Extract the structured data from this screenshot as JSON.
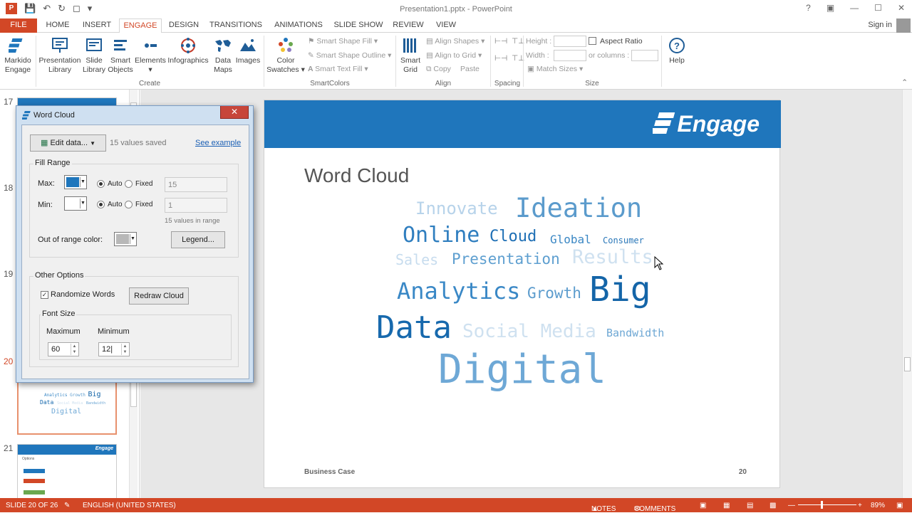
{
  "window": {
    "title": "Presentation1.pptx - PowerPoint",
    "signin": "Sign in"
  },
  "tabs": [
    "FILE",
    "HOME",
    "INSERT",
    "ENGAGE",
    "DESIGN",
    "TRANSITIONS",
    "ANIMATIONS",
    "SLIDE SHOW",
    "REVIEW",
    "VIEW"
  ],
  "ribbon": {
    "markido": [
      "Markido",
      "Engage"
    ],
    "create": {
      "presentation_library": [
        "Presentation",
        "Library"
      ],
      "slide_library": [
        "Slide",
        "Library"
      ],
      "smart_objects": [
        "Smart",
        "Objects"
      ],
      "elements": "Elements",
      "infographics": "Infographics",
      "data_maps": [
        "Data",
        "Maps"
      ],
      "images": "Images",
      "label": "Create"
    },
    "smartcolors": {
      "color_swatches": [
        "Color",
        "Swatches"
      ],
      "shape_fill": "Smart Shape Fill",
      "shape_outline": "Smart Shape Outline",
      "text_fill": "Smart Text Fill",
      "label": "SmartColors"
    },
    "align": {
      "smart_grid": [
        "Smart",
        "Grid"
      ],
      "align_shapes": "Align Shapes",
      "align_grid": "Align to Grid",
      "copy": "Copy",
      "paste": "Paste",
      "label": "Align"
    },
    "spacing": {
      "label": "Spacing"
    },
    "size": {
      "height": "Height :",
      "width": "Width :",
      "aspect": "Aspect Ratio",
      "columns": "or columns :",
      "match": "Match Sizes",
      "label": "Size"
    },
    "help": "Help"
  },
  "thumbnails": {
    "numbers": [
      "17",
      "18",
      "19",
      "20",
      "21"
    ],
    "slide20_words": [
      "Analytics",
      "Growth",
      "Big",
      "Data",
      "Social Media",
      "Bandwidth",
      "Digital"
    ],
    "slide21_title": "Options"
  },
  "slide": {
    "logo": "Engage",
    "title": "Word Cloud",
    "footer_left": "Business Case",
    "footer_right": "20",
    "words": [
      {
        "text": "Innovate",
        "color": "#b7d3ea"
      },
      {
        "text": "Ideation",
        "color": "#5b9bcc"
      },
      {
        "text": "Online",
        "color": "#2f7ebf"
      },
      {
        "text": "Cloud",
        "color": "#1e6fb5"
      },
      {
        "text": "Global",
        "color": "#3a87c4"
      },
      {
        "text": "Consumer",
        "color": "#2b78b9"
      },
      {
        "text": "Sales",
        "color": "#c7dcee"
      },
      {
        "text": "Presentation",
        "color": "#5e9fd0"
      },
      {
        "text": "Results",
        "color": "#cfe1f0"
      },
      {
        "text": "Analytics",
        "color": "#3a88c6"
      },
      {
        "text": "Growth",
        "color": "#5c9ccd"
      },
      {
        "text": "Big",
        "color": "#1465a8"
      },
      {
        "text": "Data",
        "color": "#1769ad"
      },
      {
        "text": "Social Media",
        "color": "#cfe1f0"
      },
      {
        "text": "Bandwidth",
        "color": "#6da7d4"
      },
      {
        "text": "Digital",
        "color": "#6ea8d6"
      }
    ]
  },
  "dialog": {
    "title": "Word Cloud",
    "edit_data": "Edit data...",
    "values_saved": "15 values saved",
    "see_example": "See example",
    "fill_range": "Fill Range",
    "max": "Max:",
    "min": "Min:",
    "auto": "Auto",
    "fixed": "Fixed",
    "max_value": "15",
    "min_value": "1",
    "in_range": "15 values in range",
    "out_of_range": "Out of range color:",
    "legend": "Legend...",
    "other_options": "Other Options",
    "randomize": "Randomize Words",
    "redraw": "Redraw Cloud",
    "font_size": "Font Size",
    "maximum": "Maximum",
    "minimum": "Minimum",
    "max_font": "60",
    "min_font": "12",
    "max_color": "#1f76bc",
    "out_color": "#b8b8b8"
  },
  "status": {
    "slide": "SLIDE 20 OF 26",
    "language": "ENGLISH (UNITED STATES)",
    "notes": "NOTES",
    "comments": "COMMENTS",
    "zoom": "89%"
  }
}
